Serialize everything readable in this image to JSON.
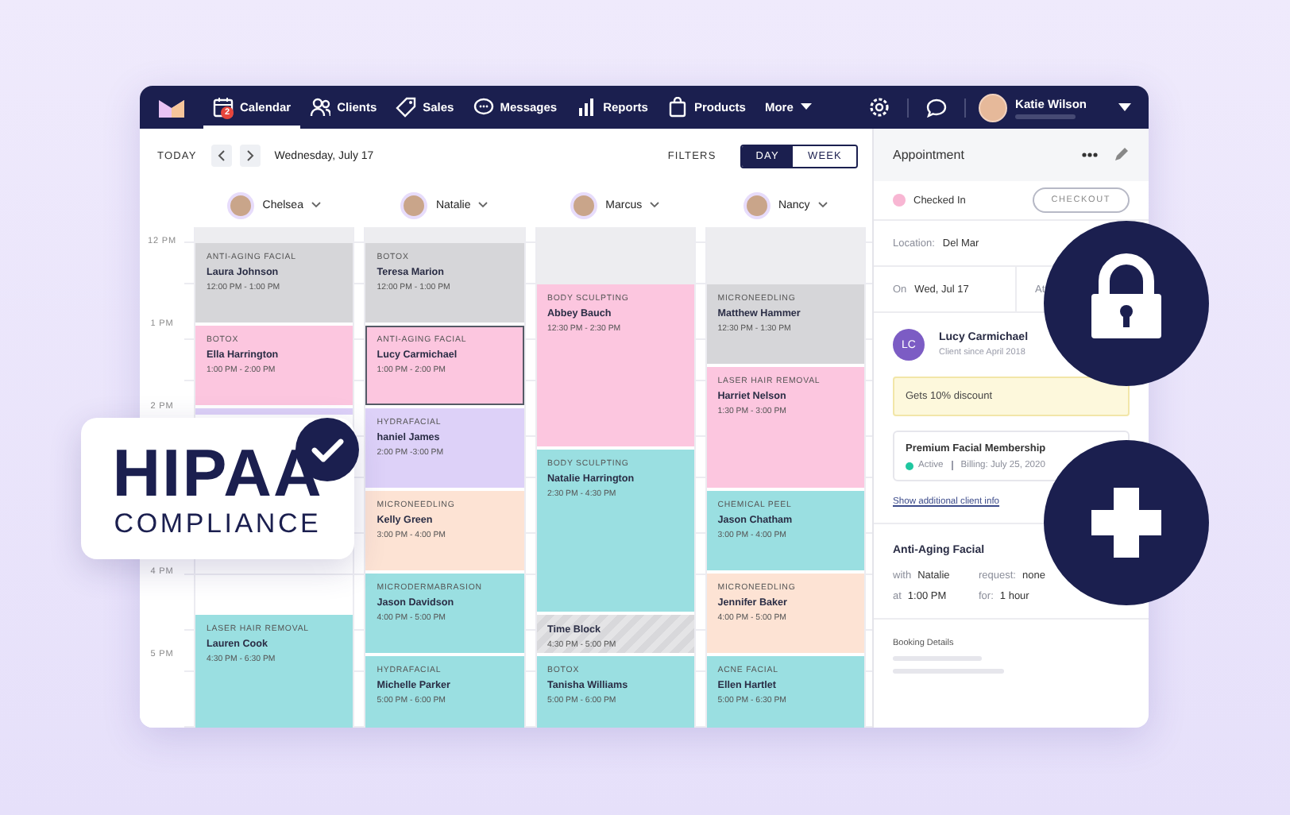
{
  "nav": {
    "items": [
      {
        "label": "Calendar",
        "kind": "calendar",
        "selected": true,
        "badge": "2"
      },
      {
        "label": "Clients",
        "kind": "people",
        "selected": false
      },
      {
        "label": "Sales",
        "kind": "tag",
        "selected": false
      },
      {
        "label": "Messages",
        "kind": "chat",
        "selected": false
      },
      {
        "label": "Reports",
        "kind": "chart",
        "selected": false
      },
      {
        "label": "Products",
        "kind": "bag",
        "selected": false
      },
      {
        "label": "More",
        "kind": "menu",
        "selected": false
      }
    ],
    "user": {
      "name": "Katie Wilson"
    }
  },
  "toolbar": {
    "today": "TODAY",
    "date": "Wednesday, July 17",
    "filters": "FILTERS",
    "views": [
      {
        "label": "DAY",
        "selected": true
      },
      {
        "label": "WEEK",
        "selected": false
      }
    ]
  },
  "time_labels": [
    "12 PM",
    "1 PM",
    "2 PM",
    "4 PM",
    "5 PM"
  ],
  "staff": [
    {
      "name": "Chelsea",
      "events": [
        {
          "kind": "appointment",
          "service": "ANTI-AGING FACIAL",
          "client": "Laura Johnson",
          "time": "12:00 PM - 1:00 PM",
          "color": "#d6d6d9",
          "selected": false
        },
        {
          "kind": "appointment",
          "service": "BOTOX",
          "client": "Ella Harrington",
          "time": "1:00 PM - 2:00 PM",
          "color": "#fcc6df",
          "selected": false
        },
        {
          "kind": "hidden",
          "color": "#ddd1f8",
          "selected": false
        },
        {
          "kind": "appointment",
          "service": "LASER HAIR REMOVAL",
          "client": "Lauren Cook",
          "time": "4:30 PM - 6:30 PM",
          "color": "#9adfe1",
          "selected": false
        }
      ]
    },
    {
      "name": "Natalie",
      "events": [
        {
          "kind": "appointment",
          "service": "BOTOX",
          "client": "Teresa Marion",
          "time": "12:00 PM - 1:00 PM",
          "color": "#d6d6d9",
          "selected": false
        },
        {
          "kind": "appointment",
          "service": "ANTI-AGING FACIAL",
          "client": "Lucy Carmichael",
          "time": "1:00 PM - 2:00 PM",
          "color": "#fcc6df",
          "selected": true
        },
        {
          "kind": "appointment",
          "service": "HYDRAFACIAL",
          "client": "haniel James",
          "time": "2:00 PM -3:00 PM",
          "color": "#ddd1f8",
          "selected": false
        },
        {
          "kind": "appointment",
          "service": "MICRONEEDLING",
          "client": "Kelly Green",
          "time": "3:00 PM - 4:00 PM",
          "color": "#fde3d4",
          "selected": false
        },
        {
          "kind": "appointment",
          "service": "MICRODERMABRASION",
          "client": "Jason Davidson",
          "time": "4:00 PM - 5:00 PM",
          "color": "#9adfe1",
          "selected": false
        },
        {
          "kind": "appointment",
          "service": "HYDRAFACIAL",
          "client": "Michelle Parker",
          "time": "5:00 PM - 6:00 PM",
          "color": "#9adfe1",
          "selected": false
        }
      ]
    },
    {
      "name": "Marcus",
      "events": [
        {
          "kind": "appointment",
          "service": "BODY SCULPTING",
          "client": "Abbey Bauch",
          "time": "12:30 PM - 2:30 PM",
          "color": "#fcc6df",
          "selected": false
        },
        {
          "kind": "appointment",
          "service": "BODY SCULPTING",
          "client": "Natalie Harrington",
          "time": "2:30 PM - 4:30 PM",
          "color": "#9adfe1",
          "selected": false
        },
        {
          "kind": "timeblock",
          "client": "Time Block",
          "time": "4:30 PM - 5:00 PM",
          "selected": false
        },
        {
          "kind": "appointment",
          "service": "BOTOX",
          "client": "Tanisha Williams",
          "time": "5:00 PM - 6:00 PM",
          "color": "#9adfe1",
          "selected": false
        }
      ]
    },
    {
      "name": "Nancy",
      "events": [
        {
          "kind": "appointment",
          "service": "MICRONEEDLING",
          "client": "Matthew Hammer",
          "time": "12:30 PM - 1:30 PM",
          "color": "#d6d6d9",
          "selected": false
        },
        {
          "kind": "appointment",
          "service": "LASER HAIR REMOVAL",
          "client": "Harriet Nelson",
          "time": "1:30 PM - 3:00 PM",
          "color": "#fcc6df",
          "selected": false
        },
        {
          "kind": "appointment",
          "service": "CHEMICAL PEEL",
          "client": "Jason Chatham",
          "time": "3:00 PM - 4:00 PM",
          "color": "#9adfe1",
          "selected": false
        },
        {
          "kind": "appointment",
          "service": "MICRONEEDLING",
          "client": "Jennifer Baker",
          "time": "4:00 PM - 5:00 PM",
          "color": "#fde3d4",
          "selected": false
        },
        {
          "kind": "appointment",
          "service": "ACNE FACIAL",
          "client": "Ellen Hartlet",
          "time": "5:00 PM - 6:30 PM",
          "color": "#9adfe1",
          "selected": false
        }
      ]
    }
  ],
  "appointment": {
    "title": "Appointment",
    "status": {
      "label": "Checked In",
      "color": "#f8b6d3"
    },
    "checkout": "CHECKOUT",
    "location": {
      "label": "Location:",
      "value": "Del Mar"
    },
    "on": {
      "label": "On",
      "value": "Wed, Jul 17"
    },
    "at": {
      "label": "At"
    },
    "client": {
      "initials": "LC",
      "name": "Lucy Carmichael",
      "since": "Client since April 2018"
    },
    "note": "Gets 10% discount",
    "membership": {
      "title": "Premium Facial Membership",
      "status": {
        "label": "Active",
        "color": "#1fc7a0"
      },
      "billing": "Billing: July 25, 2020"
    },
    "link": "Show additional client info",
    "service": {
      "title": "Anti-Aging Facial",
      "fields": [
        {
          "label": "with",
          "value": "Natalie"
        },
        {
          "label": "request:",
          "value": "none"
        },
        {
          "label": "at",
          "value": "1:00 PM"
        },
        {
          "label": "for:",
          "value": "1 hour"
        }
      ]
    },
    "booking": {
      "title": "Booking Details"
    }
  },
  "badge": {
    "title": "HIPAA",
    "subtitle": "COMPLIANCE"
  }
}
